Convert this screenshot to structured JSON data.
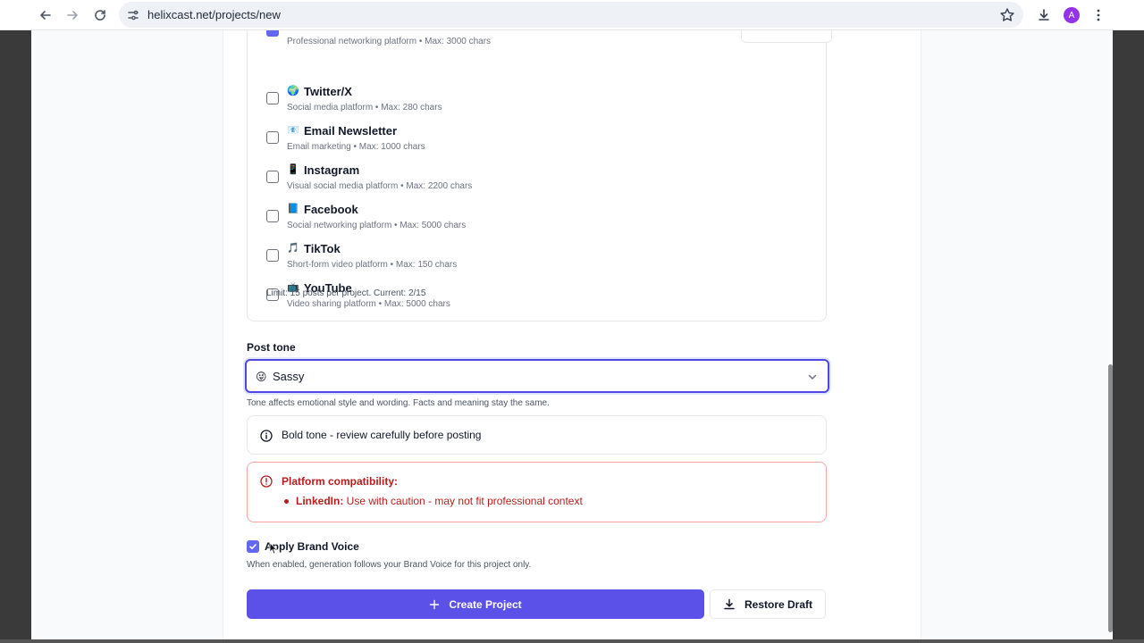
{
  "browser": {
    "url": "helixcast.net/projects/new",
    "profile_initial": "A"
  },
  "platforms": {
    "partial_top_desc": "Professional networking platform • Max: 3000 chars",
    "items": [
      {
        "emoji": "🌍",
        "name": "Twitter/X",
        "desc": "Social media platform • Max: 280 chars"
      },
      {
        "emoji": "📧",
        "name": "Email Newsletter",
        "desc": "Email marketing • Max: 1000 chars"
      },
      {
        "emoji": "📱",
        "name": "Instagram",
        "desc": "Visual social media platform • Max: 2200 chars"
      },
      {
        "emoji": "📘",
        "name": "Facebook",
        "desc": "Social networking platform • Max: 5000 chars"
      },
      {
        "emoji": "🎵",
        "name": "TikTok",
        "desc": "Short-form video platform • Max: 150 chars"
      },
      {
        "emoji": "📺",
        "name": "YouTube",
        "desc": "Video sharing platform • Max: 5000 chars"
      }
    ],
    "limit_note": "Limit: 15 posts per project. Current: 2/15"
  },
  "tone": {
    "label": "Post tone",
    "emoji": "😜",
    "value": "Sassy",
    "help": "Tone affects emotional style and wording. Facts and meaning stay the same."
  },
  "info": {
    "text": "Bold tone - review carefully before posting"
  },
  "warning": {
    "title": "Platform compatibility:",
    "platform": "LinkedIn:",
    "message": " Use with caution - may not fit professional context"
  },
  "brand_voice": {
    "label": "Apply Brand Voice",
    "checked": true,
    "help": "When enabled, generation follows your Brand Voice for this project only."
  },
  "actions": {
    "create_label": "Create Project",
    "restore_label": "Restore Draft"
  },
  "colors": {
    "accent": "#5b50e8",
    "warning": "#b91c1c"
  }
}
